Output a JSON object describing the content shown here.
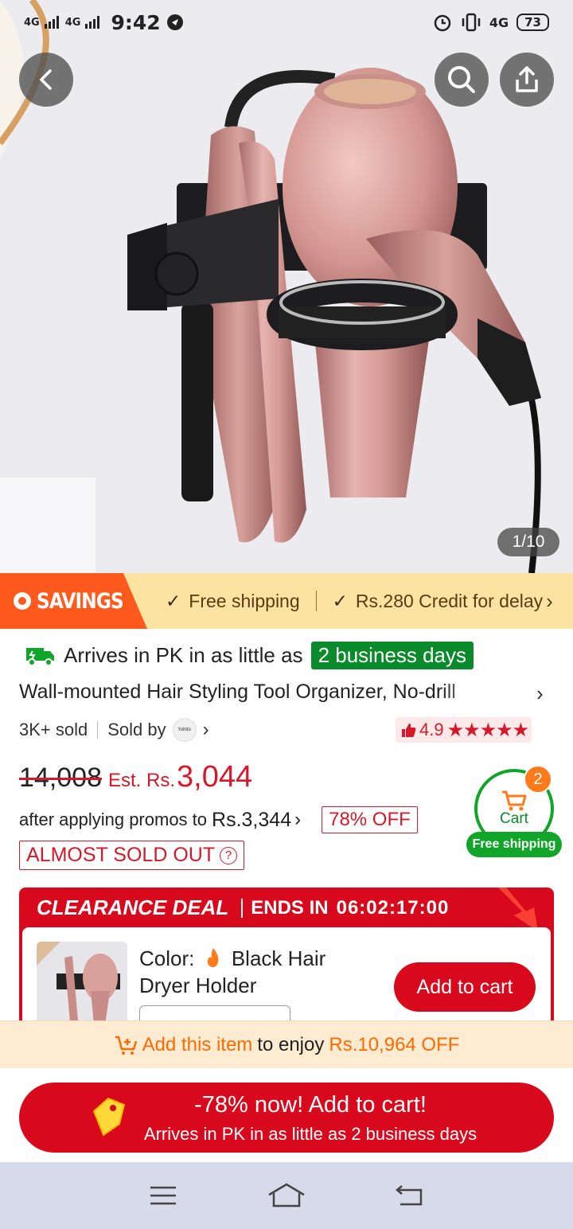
{
  "status_bar": {
    "network_left": "4G",
    "network_left2": "4G",
    "time": "9:42",
    "network_right": "4G",
    "battery": "73"
  },
  "hero": {
    "page_indicator": "1/10"
  },
  "savings": {
    "tag": "SAVINGS",
    "items": [
      "Free shipping",
      "Rs.280 Credit for delay"
    ]
  },
  "product": {
    "arrival_prefix": "Arrives in PK in as little as",
    "arrival_badge": "2 business days",
    "title": "Wall-mounted Hair Styling Tool Organizer, No-drill",
    "sold": "3K+ sold",
    "sold_by": "Sold by",
    "seller_logo_text": "Yohito",
    "rating": "4.9",
    "stars": "★★★★★",
    "old_price": "14,008",
    "est_label": "Est. Rs.",
    "est_price": "3,044",
    "promo_text": "after applying promos to",
    "promo_price": "Rs.3,344",
    "off": "78% OFF",
    "almost_sold_out": "ALMOST SOLD OUT"
  },
  "floating_cart": {
    "label": "Cart",
    "count": "2",
    "free_shipping": "Free shipping"
  },
  "clearance": {
    "title": "CLEARANCE DEAL",
    "ends_label": "ENDS IN",
    "timer": "06:02:17:00",
    "color_label": "Color:",
    "color_value": "Black Hair Dryer Holder",
    "add_to_cart": "Add to cart"
  },
  "bundle": {
    "highlight": "Add this item",
    "middle": "to enjoy",
    "amount": "Rs.10,964 OFF"
  },
  "cta": {
    "line1": "-78% now! Add to cart!",
    "line2": "Arrives in PK in as little as 2 business days"
  },
  "colors": {
    "brand_red": "#d8091c",
    "savings_orange": "#ff5a1e",
    "green": "#11a52a"
  }
}
